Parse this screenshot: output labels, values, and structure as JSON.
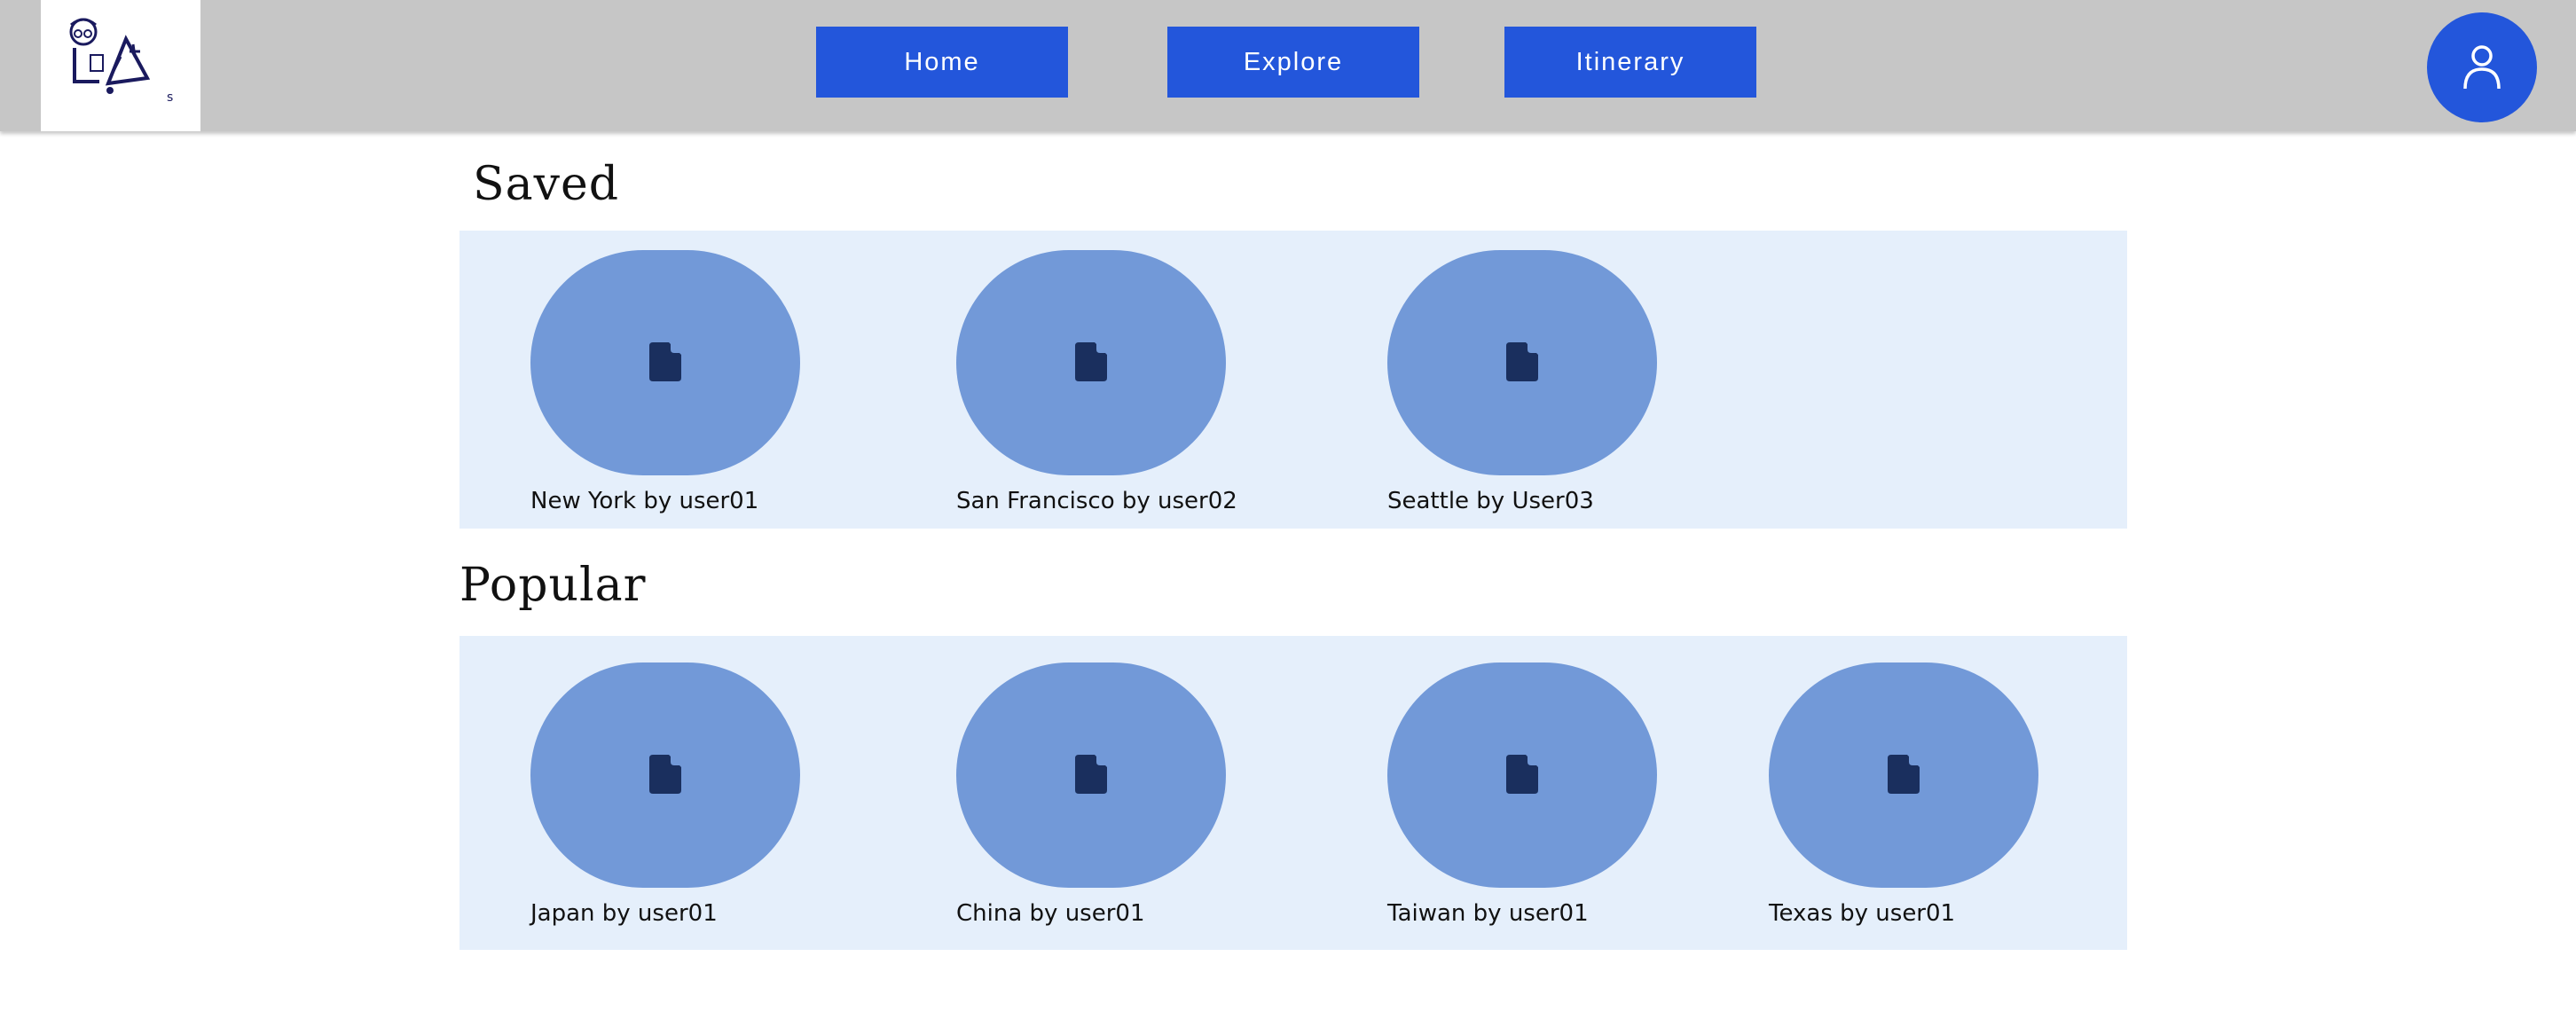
{
  "logo": {
    "icon": "travel-logo-icon",
    "tagline": "s"
  },
  "nav": [
    {
      "label": "Home"
    },
    {
      "label": "Explore"
    },
    {
      "label": "Itinerary"
    }
  ],
  "profile": {
    "icon": "user-icon"
  },
  "saved": {
    "title": "Saved",
    "items": [
      {
        "label": "New York by user01",
        "icon": "document-icon"
      },
      {
        "label": "San Francisco by user02",
        "icon": "document-icon"
      },
      {
        "label": "Seattle by User03",
        "icon": "document-icon"
      }
    ]
  },
  "popular": {
    "title": "Popular",
    "items": [
      {
        "label": "Japan by user01",
        "icon": "document-icon"
      },
      {
        "label": "China by user01",
        "icon": "document-icon"
      },
      {
        "label": "Taiwan by user01",
        "icon": "document-icon"
      },
      {
        "label": "Texas by user01",
        "icon": "document-icon"
      }
    ]
  },
  "colors": {
    "header_bg": "#c6c6c6",
    "accent": "#2356db",
    "panel_bg": "#e5effb",
    "thumb_bg": "#7299d8",
    "icon_color": "#1a2f5e"
  }
}
